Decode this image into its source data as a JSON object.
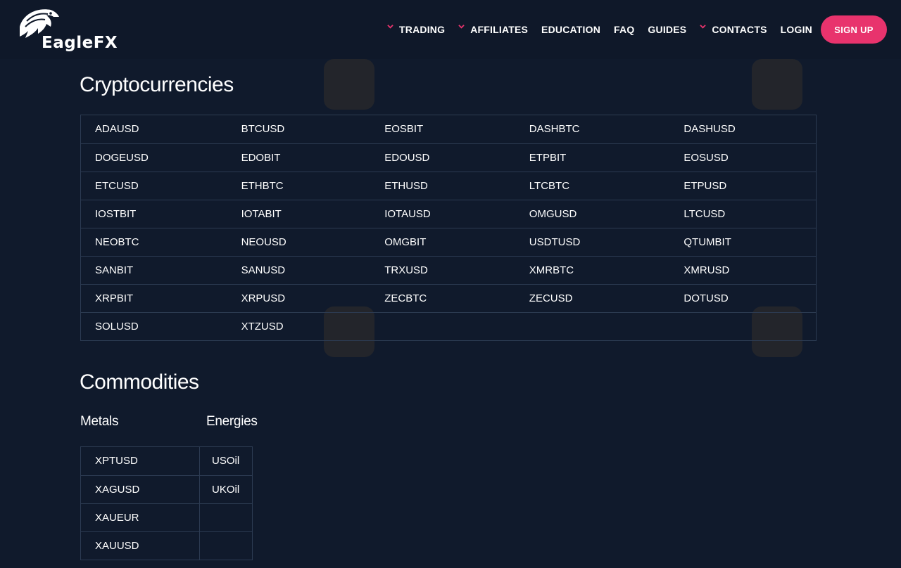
{
  "brand": {
    "name_prefix": "Eagle",
    "name_suffix": "FX"
  },
  "nav": [
    {
      "label": "TRADING",
      "dropdown": true
    },
    {
      "label": "AFFILIATES",
      "dropdown": true
    },
    {
      "label": "EDUCATION",
      "dropdown": false
    },
    {
      "label": "FAQ",
      "dropdown": false
    },
    {
      "label": "GUIDES",
      "dropdown": false
    },
    {
      "label": "CONTACTS",
      "dropdown": true
    },
    {
      "label": "LOGIN",
      "dropdown": false
    }
  ],
  "signup_label": "SIGN UP",
  "colors": {
    "accent": "#e8336d",
    "background": "#101a2c",
    "border": "#2c3b52"
  },
  "crypto": {
    "title": "Cryptocurrencies",
    "rows": [
      [
        "ADAUSD",
        "BTCUSD",
        "EOSBIT",
        "DASHBTC",
        "DASHUSD"
      ],
      [
        "DOGEUSD",
        "EDOBIT",
        "EDOUSD",
        "ETPBIT",
        "EOSUSD"
      ],
      [
        "ETCUSD",
        "ETHBTC",
        "ETHUSD",
        "LTCBTC",
        "ETPUSD"
      ],
      [
        "IOSTBIT",
        "IOTABIT",
        "IOTAUSD",
        "OMGUSD",
        "LTCUSD"
      ],
      [
        "NEOBTC",
        "NEOUSD",
        "OMGBIT",
        "USDTUSD",
        "QTUMBIT"
      ],
      [
        "SANBIT",
        "SANUSD",
        "TRXUSD",
        "XMRBTC",
        "XMRUSD"
      ],
      [
        "XRPBIT",
        "XRPUSD",
        "ZECBTC",
        "ZECUSD",
        "DOTUSD"
      ],
      [
        "SOLUSD",
        "XTZUSD",
        "",
        "",
        ""
      ]
    ]
  },
  "commodities": {
    "title": "Commodities",
    "metals_label": "Metals",
    "energies_label": "Energies",
    "rows": [
      [
        "XPTUSD",
        "USOil"
      ],
      [
        "XAGUSD",
        "UKOil"
      ],
      [
        "XAUEUR",
        ""
      ],
      [
        "XAUUSD",
        ""
      ]
    ]
  }
}
